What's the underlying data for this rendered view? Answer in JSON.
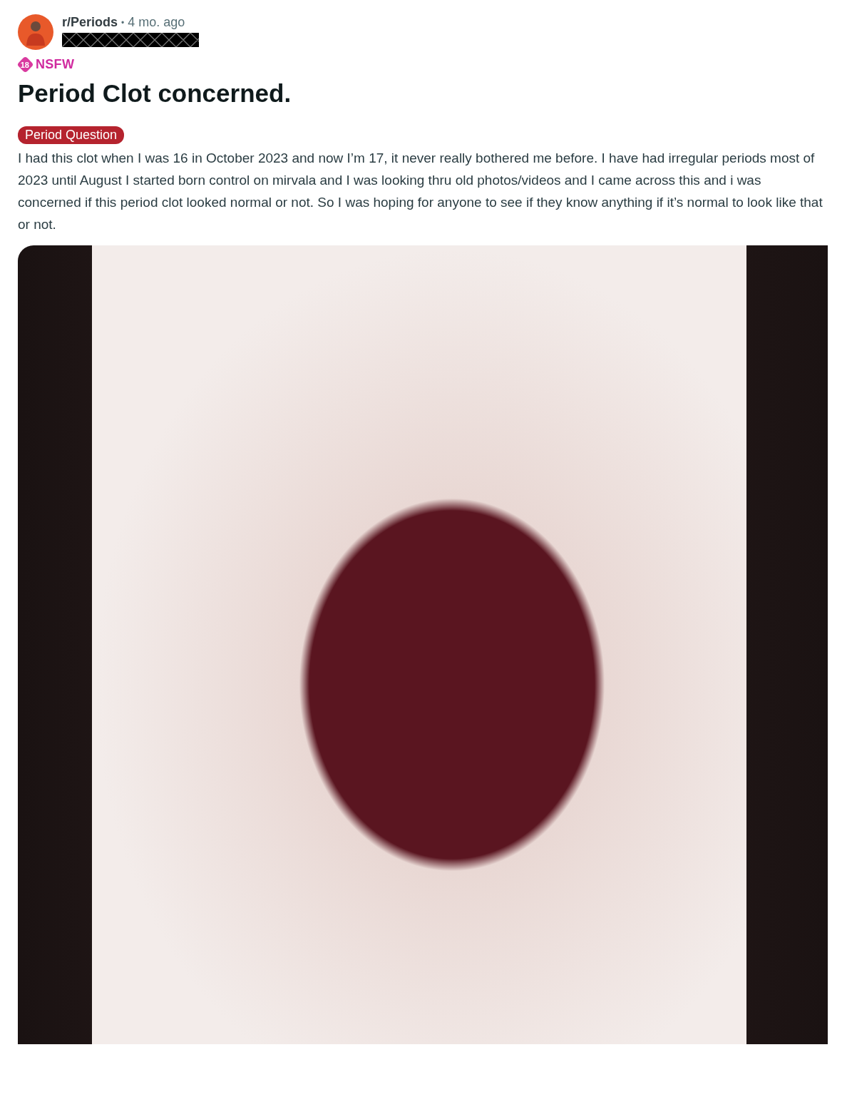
{
  "post": {
    "subreddit": "r/Periods",
    "separator": "•",
    "time": "4 mo. ago",
    "username_redacted": true,
    "nsfw": {
      "age": "18",
      "label": "NSFW"
    },
    "title": "Period Clot concerned.",
    "flair": {
      "label": "Period Question",
      "color": "#b5232e"
    },
    "body": "I had this clot when I was 16 in October 2023 and now I’m 17, it never really bothered me before. I have had irregular periods most of 2023 until August I started born control on mirvala and I was looking thru old photos/videos and I came across this and i was concerned if this period clot looked normal or not. So I was hoping for anyone to see if they know anything if it’s normal to look like that or not."
  }
}
